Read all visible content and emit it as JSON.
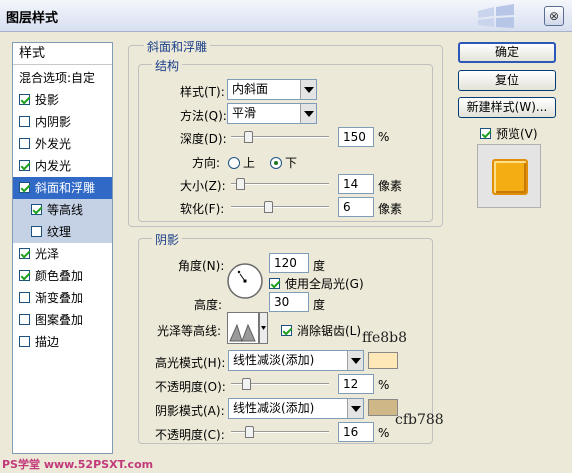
{
  "window": {
    "title": "图层样式"
  },
  "left_panel": {
    "header": "样式",
    "blend_options": "混合选项:自定",
    "items": [
      {
        "label": "投影",
        "checked": true
      },
      {
        "label": "内阴影",
        "checked": false
      },
      {
        "label": "外发光",
        "checked": false
      },
      {
        "label": "内发光",
        "checked": true
      },
      {
        "label": "斜面和浮雕",
        "checked": true
      },
      {
        "label": "等高线",
        "checked": true
      },
      {
        "label": "纹理",
        "checked": false
      },
      {
        "label": "光泽",
        "checked": true
      },
      {
        "label": "颜色叠加",
        "checked": true
      },
      {
        "label": "渐变叠加",
        "checked": false
      },
      {
        "label": "图案叠加",
        "checked": false
      },
      {
        "label": "描边",
        "checked": false
      }
    ]
  },
  "bevel": {
    "legend": "斜面和浮雕",
    "structure_legend": "结构",
    "style_label": "样式(T):",
    "style_value": "内斜面",
    "technique_label": "方法(Q):",
    "technique_value": "平滑",
    "depth_label": "深度(D):",
    "depth_value": "150",
    "depth_unit": "%",
    "depth_pct": 0.15,
    "direction_label": "方向:",
    "direction_up": "上",
    "direction_down": "下",
    "size_label": "大小(Z):",
    "size_value": "14",
    "size_unit": "像素",
    "size_pct": 0.06,
    "soften_label": "软化(F):",
    "soften_value": "6",
    "soften_unit": "像素",
    "soften_pct": 0.375
  },
  "shading": {
    "legend": "阴影",
    "angle_label": "角度(N):",
    "angle_value": "120",
    "angle_unit": "度",
    "global_light_label": "使用全局光(G)",
    "altitude_label": "高度:",
    "altitude_value": "30",
    "altitude_unit": "度",
    "gloss_contour_label": "光泽等高线:",
    "anti_aliased_label": "消除锯齿(L)",
    "highlight_mode_label": "高光模式(H):",
    "highlight_mode_value": "线性减淡(添加)",
    "highlight_color": "#ffe8b8",
    "highlight_opacity_label": "不透明度(O):",
    "highlight_opacity_value": "12",
    "highlight_opacity_unit": "%",
    "highlight_opacity_pct": 0.12,
    "shadow_mode_label": "阴影模式(A):",
    "shadow_mode_value": "线性减淡(添加)",
    "shadow_color": "#cfb788",
    "shadow_opacity_label": "不透明度(C):",
    "shadow_opacity_value": "16",
    "shadow_opacity_unit": "%",
    "shadow_opacity_pct": 0.16
  },
  "annotations": {
    "highlight_hex": "ffe8b8",
    "shadow_hex": "cfb788"
  },
  "buttons": {
    "ok": "确定",
    "reset": "复位",
    "new_style": "新建样式(W)...",
    "preview_label": "预览(V)"
  },
  "watermark": "PS学堂 www.52PSXT.com"
}
